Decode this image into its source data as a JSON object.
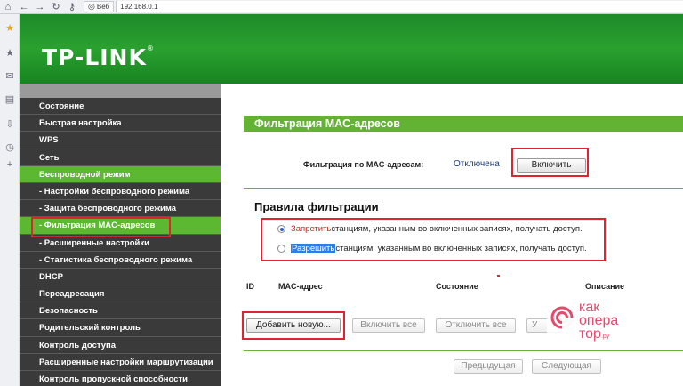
{
  "browser": {
    "web_label": "Веб",
    "url": "192.168.0.1"
  },
  "header": {
    "logo": "TP-LINK",
    "logo_mark": "®"
  },
  "menu": {
    "items": [
      {
        "label": "Состояние",
        "active": false,
        "sub": false
      },
      {
        "label": "Быстрая настройка",
        "active": false,
        "sub": false
      },
      {
        "label": "WPS",
        "active": false,
        "sub": false
      },
      {
        "label": "Сеть",
        "active": false,
        "sub": false
      },
      {
        "label": "Беспроводной режим",
        "active": true,
        "sub": false
      },
      {
        "label": "- Настройки беспроводного режима",
        "active": false,
        "sub": true
      },
      {
        "label": "- Защита беспроводного режима",
        "active": false,
        "sub": true
      },
      {
        "label": "- Фильтрация MAC-адресов",
        "active": true,
        "sub": true
      },
      {
        "label": "- Расширенные настройки",
        "active": false,
        "sub": true
      },
      {
        "label": "- Статистика беспроводного режима",
        "active": false,
        "sub": true
      },
      {
        "label": "DHCP",
        "active": false,
        "sub": false
      },
      {
        "label": "Переадресация",
        "active": false,
        "sub": false
      },
      {
        "label": "Безопасность",
        "active": false,
        "sub": false
      },
      {
        "label": "Родительский контроль",
        "active": false,
        "sub": false
      },
      {
        "label": "Контроль доступа",
        "active": false,
        "sub": false
      },
      {
        "label": "Расширенные настройки маршрутизации",
        "active": false,
        "sub": false
      },
      {
        "label": "Контроль пропускной способности",
        "active": false,
        "sub": false
      }
    ]
  },
  "content": {
    "title": "Фильтрация MAC-адресов",
    "filter_label": "Фильтрация по MAC-адресам:",
    "filter_status": "Отключена",
    "enable_button": "Включить",
    "rules_title": "Правила фильтрации",
    "rule_deny_word": "Запретить",
    "rule_deny_rest": " станциям, указанным во включенных записях, получать доступ.",
    "rule_allow_word": "Разрешить",
    "rule_allow_rest": " станциям, указанным во включенных записях, получать доступ.",
    "columns": {
      "id": "ID",
      "mac": "MAC-адрес",
      "state": "Состояние",
      "desc": "Описание"
    },
    "buttons": {
      "add_new": "Добавить новую...",
      "enable_all": "Включить все",
      "disable_all": "Отключить все",
      "delete_partial": "У",
      "prev": "Предыдущая",
      "next": "Следующая"
    }
  },
  "watermark": {
    "line1": "как",
    "line2": "опера",
    "line3": "тор",
    "suffix": ".ру"
  },
  "colors": {
    "header_green": "#2aa12f",
    "active_green": "#5cb830",
    "highlight_red": "#e0232f",
    "menu_dark": "#3a3a3a"
  }
}
